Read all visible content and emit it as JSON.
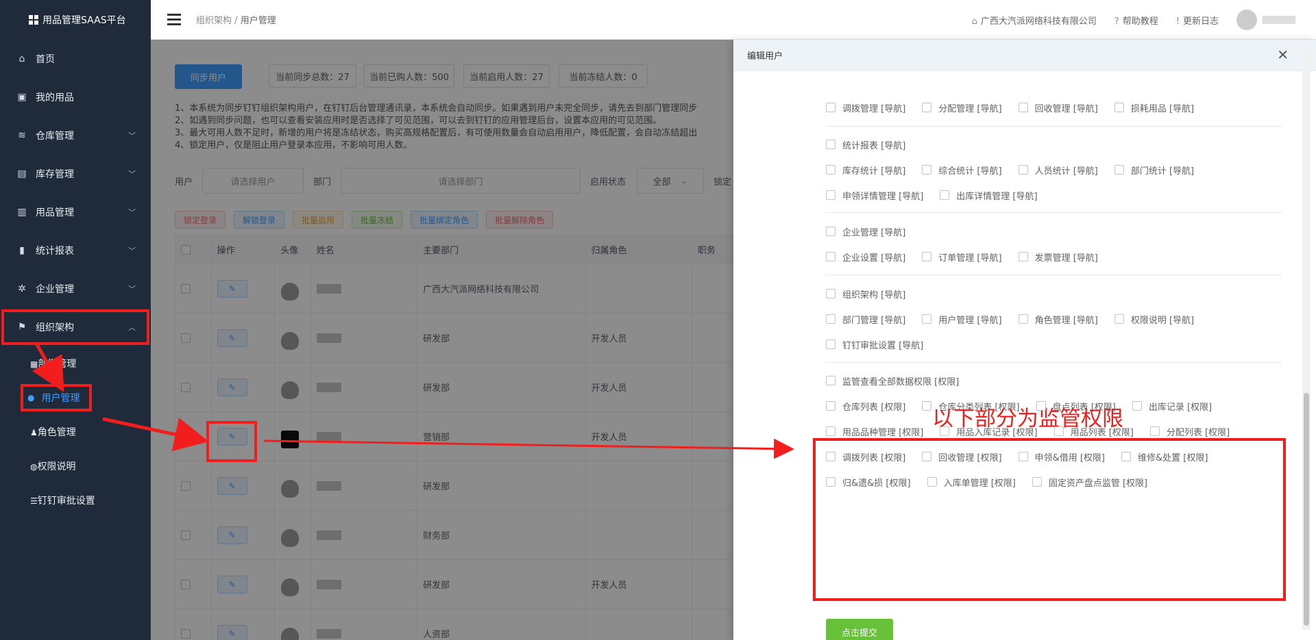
{
  "app": {
    "title": "用品管理SAAS平台"
  },
  "sidebar": {
    "items": [
      {
        "label": "首页",
        "icon": "home-icon"
      },
      {
        "label": "我的用品",
        "icon": "bag-icon"
      },
      {
        "label": "仓库管理",
        "icon": "database-icon"
      },
      {
        "label": "库存管理",
        "icon": "box-icon"
      },
      {
        "label": "用品管理",
        "icon": "package-icon"
      },
      {
        "label": "统计报表",
        "icon": "chart-icon"
      },
      {
        "label": "企业管理",
        "icon": "gear-icon"
      },
      {
        "label": "组织架构",
        "icon": "flag-icon"
      }
    ],
    "sub_items": [
      {
        "label": "部门管理",
        "icon": "grid-icon"
      },
      {
        "label": "用户管理",
        "icon": "user-icon"
      },
      {
        "label": "角色管理",
        "icon": "role-icon"
      },
      {
        "label": "权限说明",
        "icon": "location-icon"
      },
      {
        "label": "钉钉审批设置",
        "icon": "sliders-icon"
      }
    ]
  },
  "header": {
    "breadcrumb_parent": "组织架构",
    "breadcrumb_sep": "/",
    "breadcrumb_current": "用户管理",
    "company": "广西大汽派网络科技有限公司",
    "help": "帮助教程",
    "changelog": "更新日志"
  },
  "main": {
    "sync_button": "同步用户",
    "stats": [
      "当前同步总数：27",
      "当前已购人数：500",
      "当前启用人数：27",
      "当前冻结人数：0"
    ],
    "notes": [
      "1、本系统为同步钉钉组织架构用户，在钉钉后台管理通讯录，本系统会自动同步。如果遇到用户未完全同步，请先去到部门管理同步",
      "2、如遇到同步问题，也可以查看安装应用时是否选择了可见范围，可以去到钉钉的应用管理后台，设置本应用的可见范围。",
      "3、最大可用人数不足时，新增的用户将是冻结状态，购买高规格配置后，有可使用数量会自动启用用户，降低配置，会自动冻结超出",
      "4、锁定用户，仅是阻止用户登录本应用，不影响可用人数。"
    ],
    "filters": {
      "user_label": "用户",
      "user_placeholder": "请选择用户",
      "dept_label": "部门",
      "dept_placeholder": "请选择部门",
      "status_label": "启用状态",
      "status_value": "全部",
      "lock_label": "锁定"
    },
    "actions": [
      {
        "label": "锁定登录",
        "color": "#f56c6c",
        "bg": "#fef0f0",
        "border": "#fbc4c4"
      },
      {
        "label": "解锁登录",
        "color": "#409eff",
        "bg": "#ecf5ff",
        "border": "#b3d8ff"
      },
      {
        "label": "批量启用",
        "color": "#e6a23c",
        "bg": "#fdf6ec",
        "border": "#f5dab1"
      },
      {
        "label": "批量冻结",
        "color": "#67c23a",
        "bg": "#f0f9eb",
        "border": "#c2e7b0"
      },
      {
        "label": "批量绑定角色",
        "color": "#409eff",
        "bg": "#ecf5ff",
        "border": "#b3d8ff"
      },
      {
        "label": "批量解除角色",
        "color": "#f56c6c",
        "bg": "#fef0f0",
        "border": "#fbc4c4"
      }
    ],
    "columns": [
      "",
      "操作",
      "头像",
      "姓名",
      "主要部门",
      "归属角色",
      "职务"
    ],
    "rows": [
      {
        "dept": "广西大汽派网络科技有限公司",
        "role": ""
      },
      {
        "dept": "研发部",
        "role": "开发人员"
      },
      {
        "dept": "研发部",
        "role": "开发人员"
      },
      {
        "dept": "营销部",
        "role": "开发人员"
      },
      {
        "dept": "研发部",
        "role": ""
      },
      {
        "dept": "财务部",
        "role": ""
      },
      {
        "dept": "研发部",
        "role": "开发人员"
      },
      {
        "dept": "人资部",
        "role": ""
      }
    ]
  },
  "drawer": {
    "title": "编辑用户",
    "groups": [
      {
        "items": [
          "调拨管理 [导航]",
          "分配管理 [导航]",
          "回收管理 [导航]",
          "损耗用品 [导航]"
        ]
      },
      {
        "items": [
          "统计报表 [导航]"
        ]
      },
      {
        "items": [
          "库存统计 [导航]",
          "综合统计 [导航]",
          "人员统计 [导航]",
          "部门统计 [导航]"
        ]
      },
      {
        "items": [
          "申领详情管理 [导航]",
          "出库详情管理 [导航]"
        ]
      },
      {
        "items": [
          "企业管理 [导航]"
        ]
      },
      {
        "items": [
          "企业设置 [导航]",
          "订单管理 [导航]",
          "发票管理 [导航]"
        ]
      },
      {
        "items": [
          "组织架构 [导航]"
        ]
      },
      {
        "items": [
          "部门管理 [导航]",
          "用户管理 [导航]",
          "角色管理 [导航]",
          "权限说明 [导航]"
        ]
      },
      {
        "items": [
          "钉钉审批设置 [导航]"
        ]
      },
      {
        "items": [
          "监管查看全部数据权限 [权限]"
        ]
      },
      {
        "items": [
          "仓库列表 [权限]",
          "仓库分类列表 [权限]",
          "盘点列表 [权限]",
          "出库记录 [权限]"
        ]
      },
      {
        "items": [
          "用品品种管理 [权限]",
          "用品入库记录 [权限]",
          "用品列表 [权限]",
          "分配列表 [权限]"
        ]
      },
      {
        "items": [
          "调拨列表 [权限]",
          "回收管理 [权限]",
          "申领&借用 [权限]",
          "维修&处置 [权限]"
        ]
      },
      {
        "items": [
          "归&遗&损 [权限]",
          "入库单管理 [权限]",
          "固定资产盘点监管 [权限]"
        ]
      }
    ],
    "annotation": "以下部分为监管权限",
    "submit": "点击提交"
  },
  "colors": {
    "annotation_red": "#f21e1e",
    "primary": "#409eff",
    "success": "#67c23a",
    "sidebar_bg": "#1f2a3a"
  }
}
